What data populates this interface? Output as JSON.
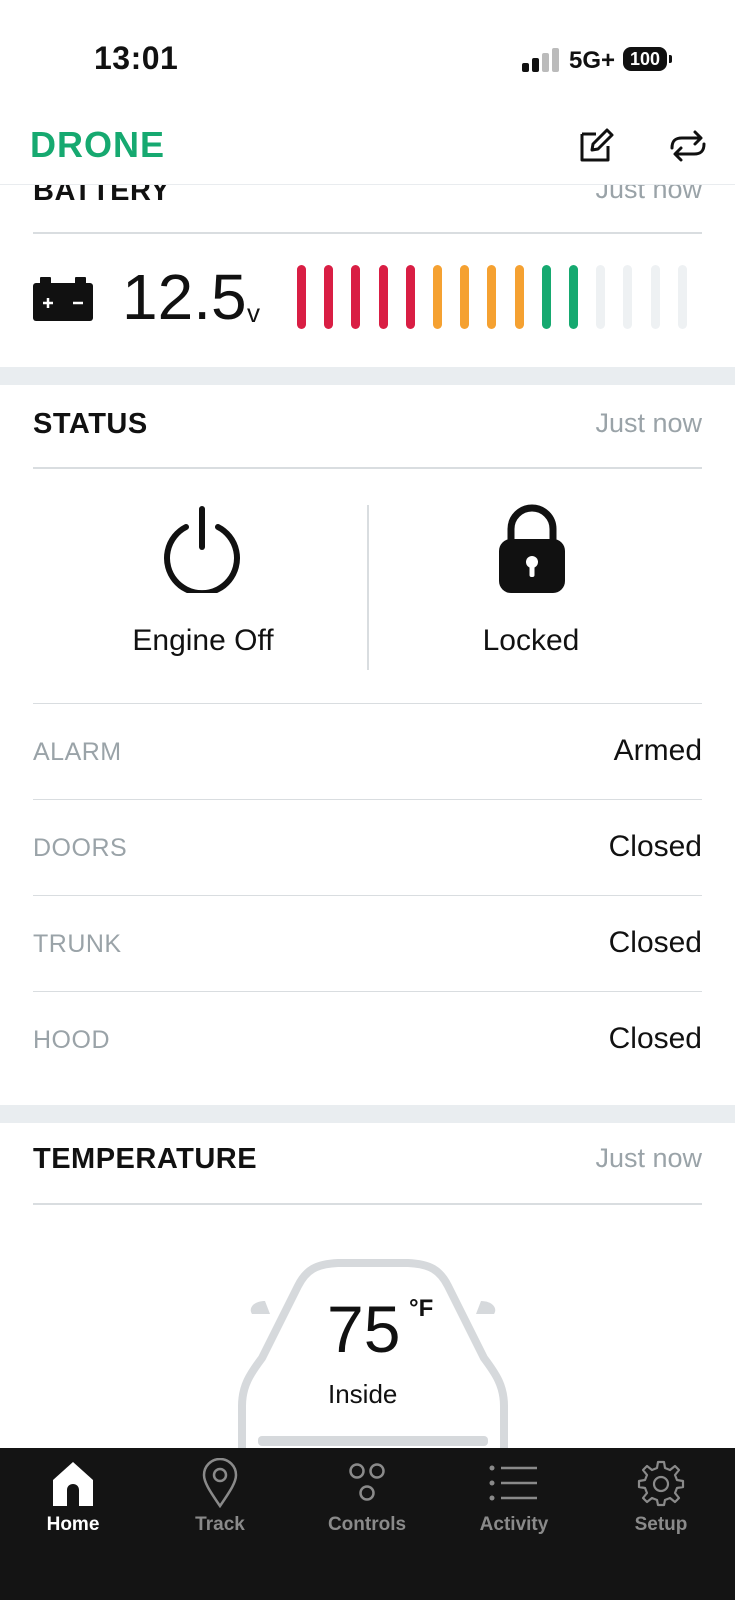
{
  "status_bar": {
    "time": "13:01",
    "network": "5G+",
    "battery": "100"
  },
  "app": {
    "logo": "DRONE",
    "icons": [
      "edit-icon",
      "swap-icon"
    ]
  },
  "battery_section": {
    "title": "BATTERY",
    "updated": "Just now",
    "voltage": "12.5",
    "unit": "V",
    "level_bars": {
      "total": 15,
      "filled": 11
    },
    "bar_colors": {
      "red": "#d91e44",
      "orange": "#f5a131",
      "green": "#16a970",
      "empty": "#eef1f3"
    }
  },
  "status_section": {
    "title": "STATUS",
    "updated": "Just now",
    "engine": {
      "label": "Engine Off",
      "icon": "power-icon"
    },
    "lock": {
      "label": "Locked",
      "icon": "lock-icon"
    },
    "rows": [
      {
        "label": "ALARM",
        "value": "Armed"
      },
      {
        "label": "DOORS",
        "value": "Closed"
      },
      {
        "label": "TRUNK",
        "value": "Closed"
      },
      {
        "label": "HOOD",
        "value": "Closed"
      }
    ]
  },
  "temperature_section": {
    "title": "TEMPERATURE",
    "updated": "Just now",
    "value": "75",
    "unit": "°F",
    "label": "Inside"
  },
  "tabs": [
    {
      "label": "Home",
      "icon": "home-icon",
      "active": true
    },
    {
      "label": "Track",
      "icon": "pin-icon",
      "active": false
    },
    {
      "label": "Controls",
      "icon": "controls-icon",
      "active": false
    },
    {
      "label": "Activity",
      "icon": "list-icon",
      "active": false
    },
    {
      "label": "Setup",
      "icon": "gear-icon",
      "active": false
    }
  ],
  "colors": {
    "brand": "#16a970",
    "muted": "#9aa3a8",
    "tabbar": "#141414"
  }
}
